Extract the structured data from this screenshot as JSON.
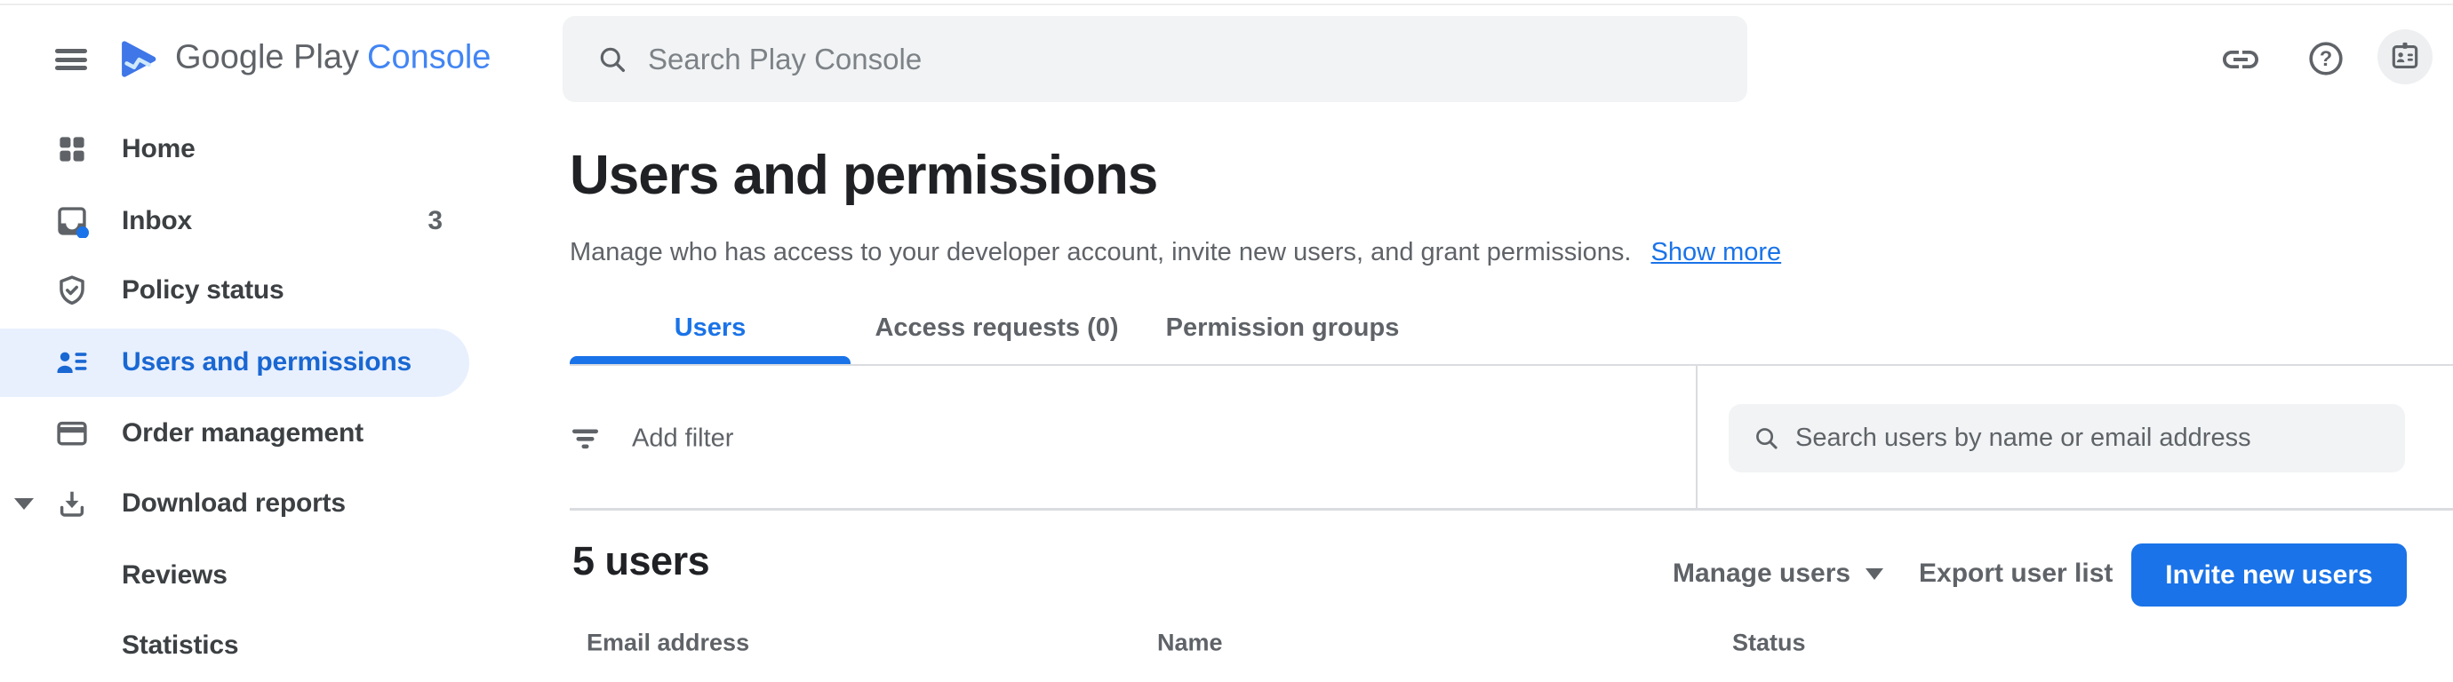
{
  "header": {
    "logo_text_primary": "Google Play",
    "logo_text_accent": "Console",
    "search_placeholder": "Search Play Console",
    "icons": [
      "hamburger-menu-icon",
      "play-logo-icon",
      "search-icon",
      "link-icon",
      "help-icon",
      "id-badge-icon"
    ]
  },
  "sidebar": {
    "items": [
      {
        "label": "Home",
        "icon": "home-grid-icon"
      },
      {
        "label": "Inbox",
        "icon": "inbox-icon",
        "badge": "3"
      },
      {
        "label": "Policy status",
        "icon": "shield-check-icon"
      },
      {
        "label": "Users and permissions",
        "icon": "person-list-icon",
        "selected": true
      },
      {
        "label": "Order management",
        "icon": "credit-card-icon"
      },
      {
        "label": "Download reports",
        "icon": "download-icon",
        "expanded": true
      },
      {
        "label": "Reviews",
        "child": true
      },
      {
        "label": "Statistics",
        "child": true
      }
    ]
  },
  "main": {
    "title": "Users and permissions",
    "description": "Manage who has access to your developer account, invite new users, and grant permissions.",
    "show_more_label": "Show more",
    "tabs": [
      {
        "label": "Users",
        "active": true
      },
      {
        "label": "Access requests (0)",
        "active": false
      },
      {
        "label": "Permission groups",
        "active": false
      }
    ],
    "filter_bar": {
      "add_filter_label": "Add filter",
      "user_search_placeholder": "Search users by name or email address"
    },
    "users_section": {
      "count_label": "5 users",
      "manage_users_label": "Manage users",
      "export_label": "Export user list",
      "invite_label": "Invite new users",
      "table_headers": [
        "Email address",
        "Name",
        "Status"
      ]
    }
  },
  "colors": {
    "accent_blue": "#1a73e8",
    "logo_console_blue": "#4285f4",
    "selected_item_bg": "#e8f0fe",
    "selected_item_text": "#1967d2",
    "icon_grey": "#5f6368",
    "text_dark": "#202124",
    "text_grey": "#5f6368",
    "surface_grey": "#f1f3f4",
    "divider_grey": "#dadce0"
  }
}
